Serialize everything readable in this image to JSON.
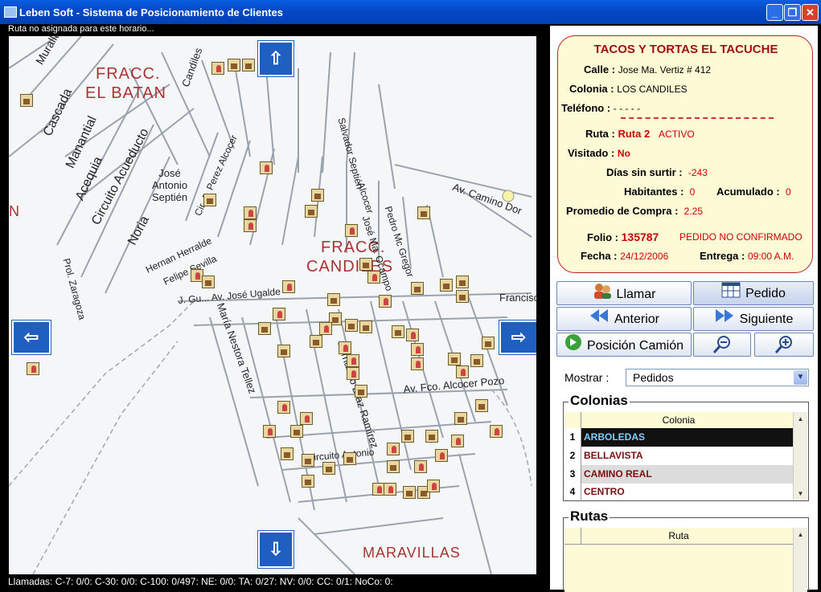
{
  "window": {
    "title": "Leben Soft - Sistema de Posicionamiento de Clientes",
    "minimize": "_",
    "maximize": "❐",
    "close": "✕"
  },
  "map": {
    "status_top": "Ruta no asignada para este horario...",
    "status_bottom": "Llamadas: C-7: 0/0: C-30: 0/0: C-100: 0/497: NE: 0/0: TA: 0/27: NV: 0/0: CC: 0/1: NoCo: 0:",
    "labels": {
      "fracc_batan_1": "FRACC.",
      "fracc_batan_2": "EL BATAN",
      "fracc_candiles_1": "FRACC.",
      "fracc_candiles_2": "CANDILES",
      "maravillas": "MARAVILLAS",
      "cascada": "Cascada",
      "manantial": "Manantial",
      "acequia": "Acequia",
      "circuito_acueducto": "Circuito Acueducto",
      "noria": "Noria",
      "prol_zaragoza": "Prol. Zaragoza",
      "jose_antonio_septien": "José Antonio Septién",
      "muralla": "Muralla",
      "candiles": "Candiles",
      "av_camino_dorado": "Av. Camino Dor",
      "francisco": "Francisc",
      "maria_nestora_tellez": "María Nestora Tellez",
      "fernando_diaz_ramirez": "Fernando Díaz Ramírez",
      "av_fco_alcocer": "Av. Fco. Alcocer Pozo",
      "hernan_herralde": "Hernan Herralde",
      "felipe_sevilla": "Felipe Sevilla",
      "j_g_av_jose_ugalde": "J. Gu... Av. José Ugalde",
      "cir_a_perez_alcocer": "Cir. A. Perez Alcocer",
      "salvador_septien": "Salvador Septién",
      "pedro_mc_gregor": "Pedro Mc Gregor",
      "jose_ma_ocampo": "José Ma. Ocampo",
      "circuito_antonio": "Circuito Antonio",
      "alcocer": "Alcocer",
      "n_edge": "N"
    }
  },
  "client": {
    "name": "TACOS Y TORTAS EL TACUCHE",
    "calle_label": "Calle :",
    "calle": "Jose Ma. Vertiz # 412",
    "colonia_label": "Colonia :",
    "colonia": "LOS CANDILES",
    "telefono_label": "Teléfono :",
    "telefono": "- - - - -",
    "ruta_label": "Ruta :",
    "ruta": "Ruta 2",
    "ruta_status": "ACTIVO",
    "visitado_label": "Visitado :",
    "visitado": "No",
    "dias_label": "Días sin surtir :",
    "dias": "-243",
    "habitantes_label": "Habitantes :",
    "habitantes": "0",
    "acumulado_label": "Acumulado :",
    "acumulado": "0",
    "promedio_label": "Promedio de Compra :",
    "promedio": "2.25",
    "folio_label": "Folio :",
    "folio": "135787",
    "pedido_status": "PEDIDO NO CONFIRMADO",
    "fecha_label": "Fecha :",
    "fecha": "24/12/2006",
    "entrega_label": "Entrega :",
    "entrega": "09:00 A.M."
  },
  "buttons": {
    "llamar": "Llamar",
    "pedido": "Pedido",
    "anterior": "Anterior",
    "siguiente": "Siguiente",
    "posicion_camion": "Posición Camión"
  },
  "mostrar": {
    "label": "Mostrar :",
    "value": "Pedidos"
  },
  "colonias": {
    "title": "Colonias",
    "column": "Colonia",
    "rows": [
      {
        "num": "1",
        "name": "ARBOLEDAS"
      },
      {
        "num": "2",
        "name": "BELLAVISTA"
      },
      {
        "num": "3",
        "name": "CAMINO REAL"
      },
      {
        "num": "4",
        "name": "CENTRO"
      }
    ]
  },
  "rutas": {
    "title": "Rutas",
    "column": "Ruta"
  },
  "colors": {
    "titlebar": "#0449c8",
    "card_bg": "#fdfbd6",
    "accent_red": "#c00000",
    "selected_row_text": "#7fd0ff"
  }
}
